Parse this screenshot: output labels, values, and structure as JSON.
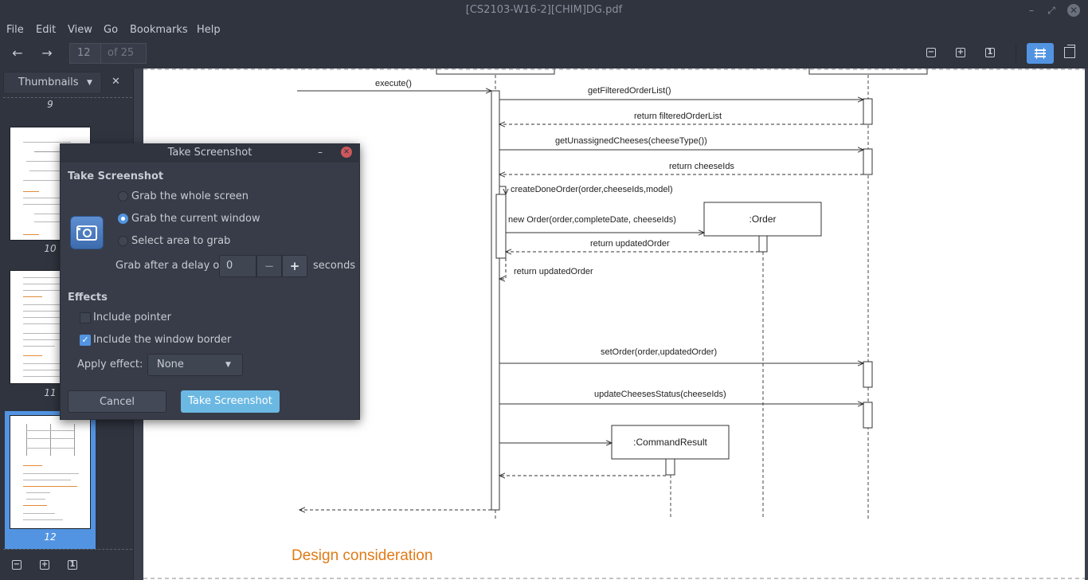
{
  "window": {
    "title": "[CS2103-W16-2][CHIM]DG.pdf",
    "minimize": "–",
    "restore": "⤢",
    "close": "✕"
  },
  "menu": [
    "File",
    "Edit",
    "View",
    "Go",
    "Bookmarks",
    "Help"
  ],
  "toolbar": {
    "back": "←",
    "forward": "→",
    "page_value": "12",
    "page_total": "of 25",
    "zoom_out": "−",
    "zoom_in": "+",
    "fit": "1"
  },
  "sidebar": {
    "header": "Thumbnails",
    "close": "✕",
    "page_labels": [
      "9",
      "10",
      "11",
      "12"
    ],
    "bottom_icons": [
      "−",
      "+",
      "1"
    ]
  },
  "document": {
    "messages": [
      "execute()",
      "getFilteredOrderList()",
      "return filteredOrderList",
      "getUnassignedCheeses(cheeseType())",
      "return cheeseIds",
      "createDoneOrder(order,cheeseIds,model)",
      "new Order(order,completeDate, cheeseIds)",
      "return updatedOrder",
      "return updatedOrder",
      "setOrder(order,updatedOrder)",
      "updateCheesesStatus(cheeseIds)"
    ],
    "objects": [
      ":Order",
      ":CommandResult"
    ],
    "heading": "Design consideration"
  },
  "dialog": {
    "title": "Take Screenshot",
    "minimize": "–",
    "close": "✕",
    "section_title": "Take Screenshot",
    "options": [
      "Grab the whole screen",
      "Grab the current window",
      "Select area to grab"
    ],
    "selected_option": 1,
    "delay_label": "Grab after a delay of",
    "delay_value": "0",
    "delay_minus": "−",
    "delay_plus": "+",
    "delay_unit": "seconds",
    "effects_title": "Effects",
    "include_pointer": "Include pointer",
    "include_pointer_checked": false,
    "include_border": "Include the window border",
    "include_border_checked": true,
    "apply_effect_label": "Apply effect:",
    "apply_effect_value": "None",
    "cancel": "Cancel",
    "confirm": "Take Screenshot"
  },
  "colors": {
    "accent": "#5294e2",
    "heading_orange": "#e07b17"
  }
}
